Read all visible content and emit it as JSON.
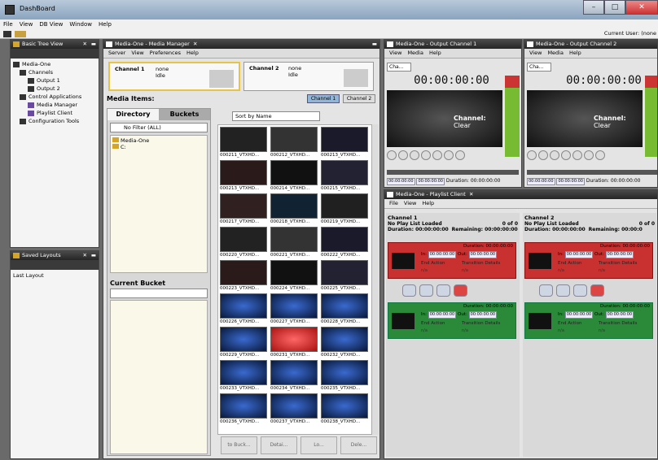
{
  "app": {
    "title": "DashBoard",
    "current_user_label": "Current User: (none"
  },
  "menubar": [
    "File",
    "View",
    "DB View",
    "Window",
    "Help"
  ],
  "left_panel": {
    "title": "Basic Tree View",
    "tree": [
      "Media-One",
      "Channels",
      "Output 1",
      "Output 2",
      "Control Applications",
      "Media Manager",
      "Playlist Client",
      "Configuration Tools"
    ]
  },
  "saved_layouts": {
    "title": "Saved Layouts",
    "items": [
      "Last Layout"
    ]
  },
  "media_manager": {
    "title": "Media-One - Media Manager",
    "menu": [
      "Server",
      "View",
      "Preferences",
      "Help"
    ],
    "channel1": {
      "name": "Channel 1",
      "clip": "none",
      "state": "Idle"
    },
    "channel2": {
      "name": "Channel 2",
      "clip": "none",
      "state": "Idle"
    },
    "media_items_label": "Media Items:",
    "channel_btn1": "Channel 1",
    "channel_btn2": "Channel 2",
    "tabs": [
      "Directory",
      "Buckets"
    ],
    "filter": "No Filter (ALL)",
    "dir_tree": [
      "Media-One",
      "C:"
    ],
    "sort": "Sort by Name",
    "current_bucket": "Current Bucket",
    "thumbs": [
      "000211_VTXHD...",
      "000212_VTXHD...",
      "000213_VTXHD...",
      "000213_VTXHD...",
      "000214_VTXHD...",
      "000215_VTXHD...",
      "000217_VTXHD...",
      "000218_VTXHD...",
      "000219_VTXHD...",
      "000220_VTXHD...",
      "000221_VTXHD...",
      "000222_VTXHD...",
      "000223_VTXHD...",
      "000224_VTXHD...",
      "000225_VTXHD...",
      "000226_VTXHD...",
      "000227_VTXHD...",
      "000228_VTXHD...",
      "000229_VTXHD...",
      "000231_VTXHD...",
      "000232_VTXHD...",
      "000233_VTXHD...",
      "000234_VTXHD...",
      "000235_VTXHD...",
      "000236_VTXHD...",
      "000237_VTXHD...",
      "000238_VTXHD..."
    ],
    "bottom_buttons": [
      "to Buck...",
      "Detai...",
      "Lo...",
      "Dele..."
    ]
  },
  "output1": {
    "title": "Media-One - Output Channel 1",
    "menu": [
      "View",
      "Media",
      "Help"
    ],
    "select": "Cha...",
    "timecode": "00:00:00:00",
    "channel_label": "Channel:",
    "channel_value": "Clear",
    "tc1": "00:00:00:00",
    "tc2": "00:00:00:00",
    "duration": "Duration: 00:00:00:00"
  },
  "output2": {
    "title": "Media-One - Output Channel 2",
    "menu": [
      "View",
      "Media",
      "Help"
    ],
    "select": "Cha...",
    "timecode": "00:00:00:00",
    "channel_label": "Channel:",
    "channel_value": "Clear",
    "tc1": "00:00:00:00",
    "tc2": "00:00:00:00",
    "duration": "Duration: 00:00:00:00"
  },
  "playlist": {
    "title": "Media-One - Playlist Client",
    "menu": [
      "File",
      "View",
      "Help"
    ],
    "ch1": {
      "name": "Channel 1",
      "loaded": "No Play List Loaded",
      "count": "0 of 0",
      "duration": "Duration: 00:00:00:00",
      "remaining": "Remaining: 00:00:00:00"
    },
    "ch2": {
      "name": "Channel 2",
      "loaded": "No Play List Loaded",
      "count": "0 of 0",
      "duration": "Duration: 00:00:00:00",
      "remaining": "Remaining: 00:00:0"
    },
    "cue": {
      "duration": "Duration: 00:00:00:00",
      "in_label": "In:",
      "in": "00:00:00:00",
      "out_label": "Out:",
      "out": "00:00:00:00",
      "end_action": "End Action",
      "transition": "Transition Details",
      "na": "n/a"
    }
  }
}
